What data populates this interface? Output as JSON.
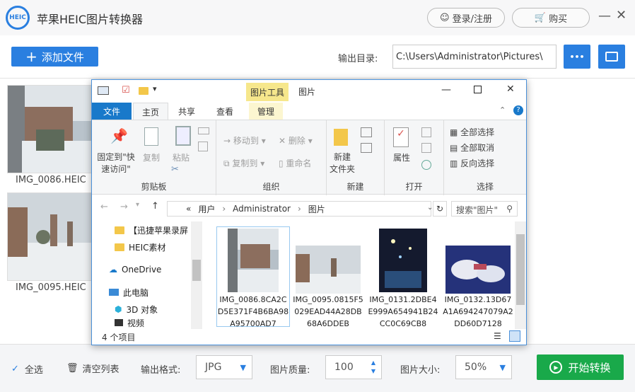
{
  "app": {
    "title": "苹果HEIC图片转换器",
    "logo_text": "HEIC",
    "login_label": "登录/注册",
    "buy_label": "购买",
    "accent": "#2a7fe0"
  },
  "toolbar": {
    "add_file": "添加文件",
    "output_dir_label": "输出目录:",
    "output_dir": "C:\\Users\\Administrator\\Pictures\\",
    "more": "•••"
  },
  "files": [
    {
      "name": "IMG_0086.HEIC"
    },
    {
      "name": "IMG_0095.HEIC"
    }
  ],
  "bottom": {
    "select_all": "全选",
    "clear_list": "清空列表",
    "format_label": "输出格式:",
    "format": "JPG",
    "quality_label": "图片质量:",
    "quality": "100",
    "size_label": "图片大小:",
    "size": "50%",
    "start": "开始转换",
    "start_color": "#19a94a"
  },
  "explorer": {
    "context_tab": "图片工具",
    "window_title": "图片",
    "tabs": [
      "文件",
      "主页",
      "共享",
      "查看",
      "管理"
    ],
    "clipboard": {
      "pin": "固定到\"快速访问\"",
      "copy": "复制",
      "paste": "粘贴",
      "label": "剪贴板"
    },
    "organize": {
      "move_to": "移动到",
      "copy_to": "复制到",
      "delete": "删除",
      "rename": "重命名",
      "label": "组织"
    },
    "new": {
      "new_folder": "新建\n文件夹",
      "label": "新建"
    },
    "open": {
      "properties": "属性",
      "label": "打开"
    },
    "select": {
      "select_all": "全部选择",
      "select_none": "全部取消",
      "invert": "反向选择",
      "label": "选择"
    },
    "address": {
      "prefix": "«",
      "parts": [
        "用户",
        "Administrator",
        "图片"
      ],
      "search_placeholder": "搜索\"图片\""
    },
    "nav": [
      "【迅捷苹果录屏",
      "HEIC素材",
      "OneDrive",
      "此电脑",
      "3D 对象",
      "视频"
    ],
    "items": [
      {
        "name": "IMG_0086.8CA2CD5E371F4B6BA98A95700AD7"
      },
      {
        "name": "IMG_0095.0815F5029EAD44A28DB68A6DDEB"
      },
      {
        "name": "IMG_0131.2DBE4E999A654941B24CC0C69CB8"
      },
      {
        "name": "IMG_0132.13D67A1A694247079A2DD60D7128"
      }
    ],
    "status": "4 个项目"
  }
}
